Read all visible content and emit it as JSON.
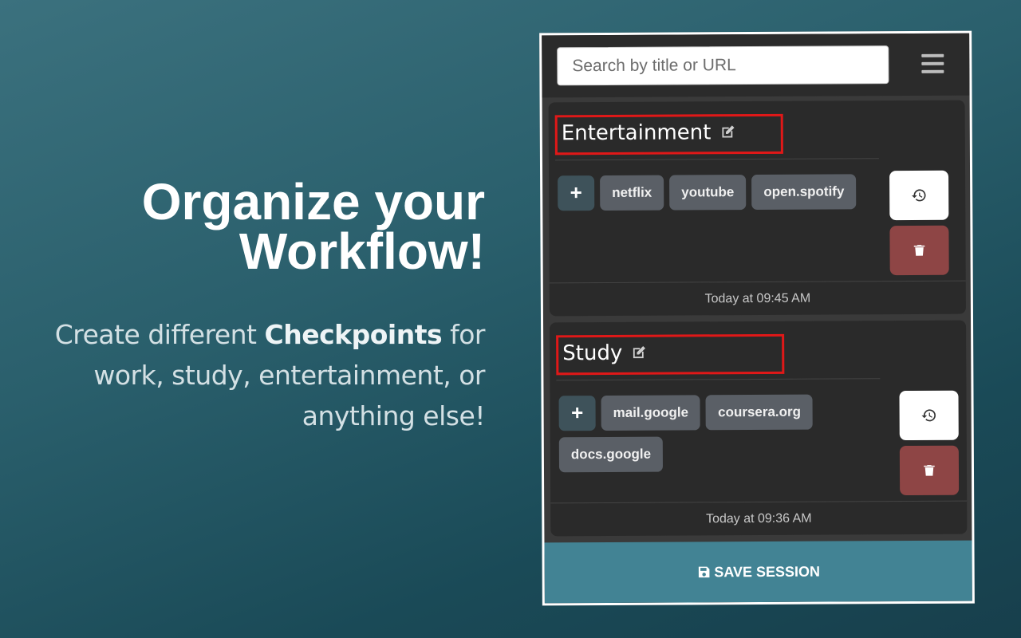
{
  "promo": {
    "headline_line1": "Organize your",
    "headline_line2": "Workflow!",
    "sub_part1": "Create different ",
    "sub_bold": "Checkpoints",
    "sub_part2": " for work, study, entertainment, or anything else!"
  },
  "popup": {
    "search": {
      "placeholder": "Search by title or URL",
      "value": ""
    },
    "menu_icon": "hamburger-menu-icon",
    "sessions": [
      {
        "title": "Entertainment",
        "tags": [
          "netflix",
          "youtube",
          "open.spotify"
        ],
        "timestamp": "Today at 09:45 AM"
      },
      {
        "title": "Study",
        "tags": [
          "mail.google",
          "coursera.org",
          "docs.google"
        ],
        "timestamp": "Today at 09:36 AM"
      }
    ],
    "add_tag_label": "+",
    "save_label": "SAVE SESSION"
  },
  "colors": {
    "accent": "#428394",
    "delete": "#8e4545",
    "highlight_box": "#e01818"
  }
}
